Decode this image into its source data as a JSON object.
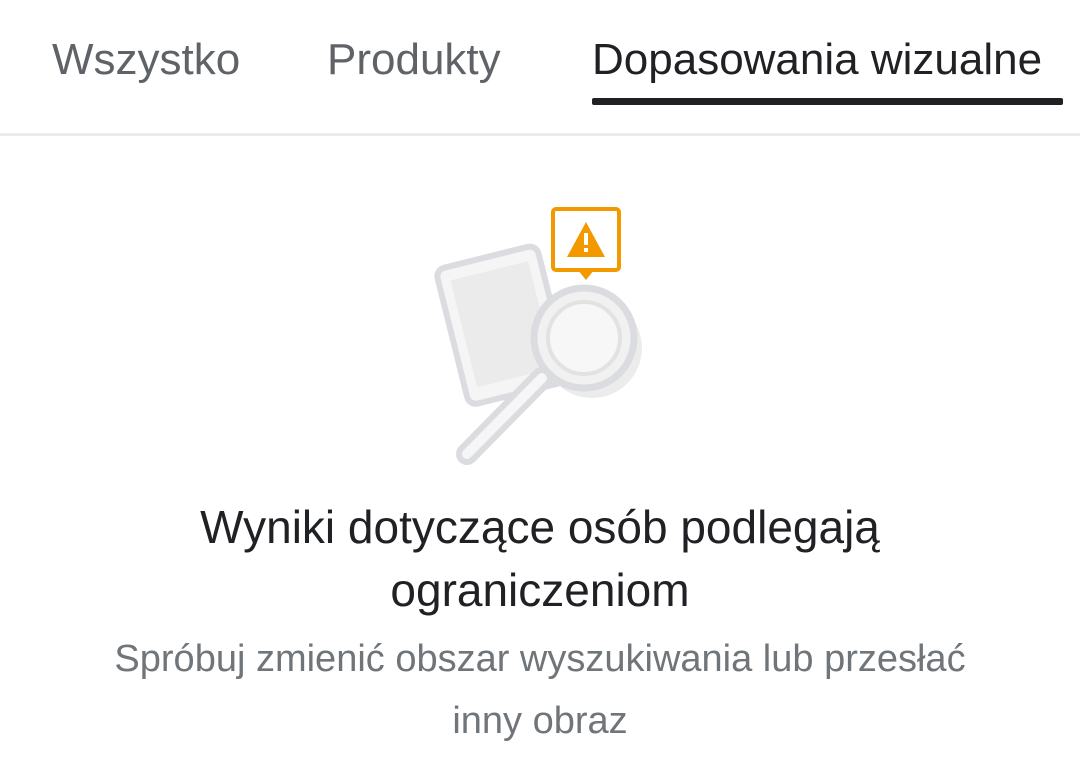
{
  "tabs": {
    "all_label": "Wszystko",
    "products_label": "Produkty",
    "visual_label": "Dopasowania wizualne",
    "active": "Dopasowania wizualne"
  },
  "illustration": {
    "icon": "warning-magnifier-icon",
    "warning_color": "#f29900",
    "glyph_color": "#dadce0"
  },
  "message": {
    "title": "Wyniki dotyczące osób podlegają ograniczeniom",
    "subtitle": "Spróbuj zmienić obszar wyszukiwania lub przesłać inny obraz"
  }
}
